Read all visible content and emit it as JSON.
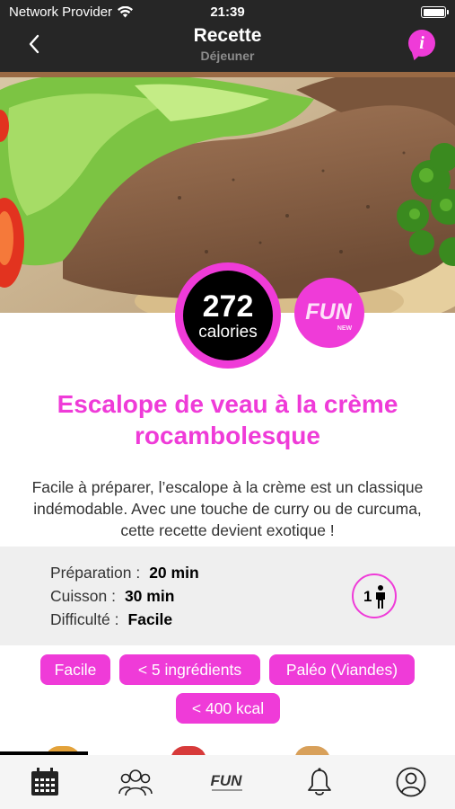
{
  "status_bar": {
    "carrier": "Network Provider",
    "time": "21:39"
  },
  "header": {
    "title": "Recette",
    "subtitle": "Déjeuner",
    "info_icon": "info-icon",
    "back_icon": "chevron-left-icon"
  },
  "badges": {
    "calories_value": "272",
    "calories_unit": "calories",
    "logo_text": "FUN",
    "logo_subtext": "NEW"
  },
  "recipe": {
    "title": "Escalope de veau à la crème rocambolesque",
    "description": "Facile à préparer, l’escalope à la crème est un classique indémodable. Avec une touche de curry ou de curcuma, cette recette devient exotique !"
  },
  "details": {
    "prep_label": "Préparation :",
    "prep_value": "20 min",
    "cook_label": "Cuisson :",
    "cook_value": "30 min",
    "difficulty_label": "Difficulté :",
    "difficulty_value": "Facile",
    "servings": "1"
  },
  "tags": [
    "Facile",
    "< 5 ingrédients",
    "Paléo (Viandes)",
    "< 400 kcal"
  ],
  "tabbar": {
    "items": [
      {
        "icon": "calendar-icon"
      },
      {
        "icon": "community-icon"
      },
      {
        "icon": "fun-logo-icon"
      },
      {
        "icon": "bell-icon"
      },
      {
        "icon": "profile-icon"
      }
    ]
  },
  "colors": {
    "accent": "#ef3bd8",
    "header_bg": "#262626",
    "details_bg": "#efefef"
  }
}
